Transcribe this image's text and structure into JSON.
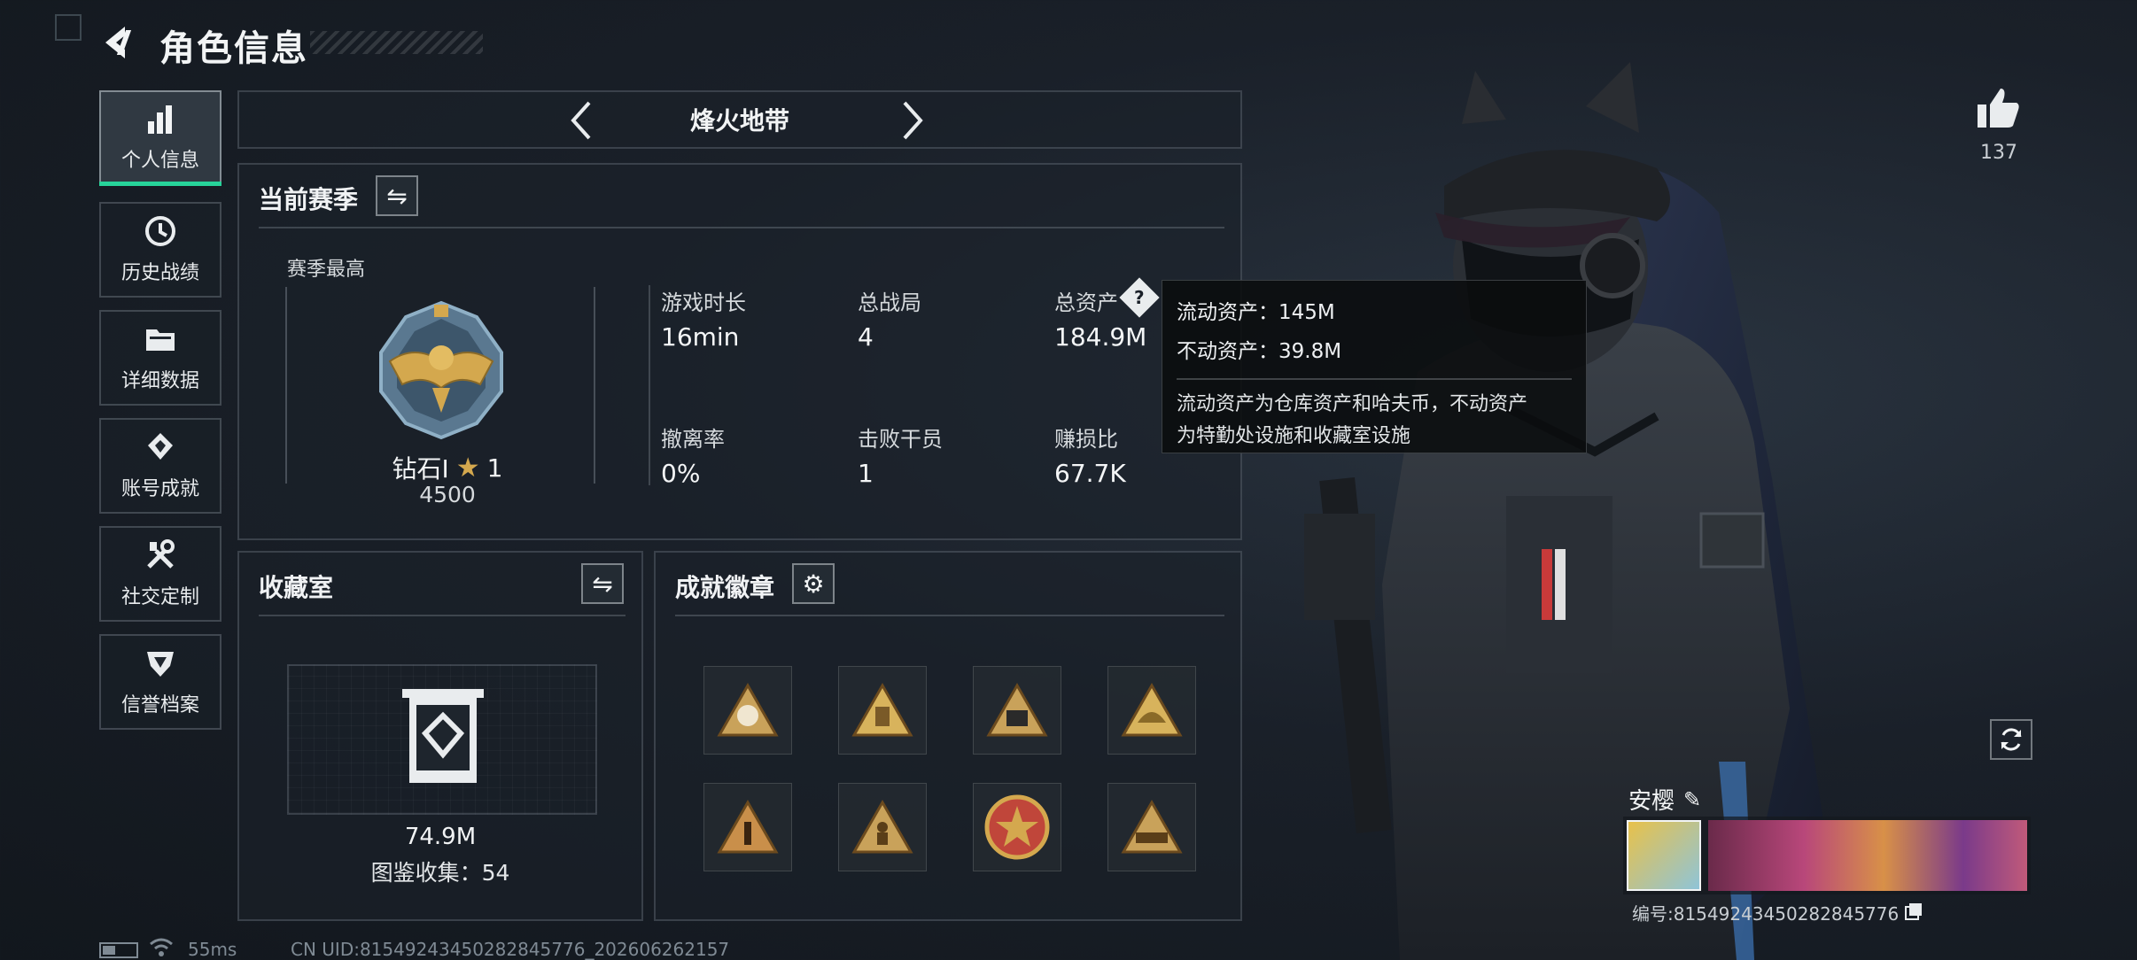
{
  "header": {
    "title": "角色信息"
  },
  "sidebar": {
    "items": [
      {
        "label": "个人信息",
        "icon": "bar-chart-icon",
        "active": true
      },
      {
        "label": "历史战绩",
        "icon": "history-icon",
        "active": false
      },
      {
        "label": "详细数据",
        "icon": "folder-icon",
        "active": false
      },
      {
        "label": "账号成就",
        "icon": "achievement-icon",
        "active": false
      },
      {
        "label": "社交定制",
        "icon": "tools-icon",
        "active": false
      },
      {
        "label": "信誉档案",
        "icon": "credit-icon",
        "active": false
      }
    ]
  },
  "mode_selector": {
    "label": "烽火地带"
  },
  "season": {
    "title": "当前赛季",
    "best_label": "赛季最高",
    "rank": "钻石Ⅰ",
    "stars": "1",
    "score": "4500",
    "stats": [
      {
        "label": "游戏时长",
        "value": "16min"
      },
      {
        "label": "总战局",
        "value": "4"
      },
      {
        "label": "总资产",
        "value": "184.9M"
      },
      {
        "label": "撤离率",
        "value": "0%"
      },
      {
        "label": "击败干员",
        "value": "1"
      },
      {
        "label": "赚损比",
        "value": "67.7K"
      }
    ]
  },
  "tooltip": {
    "liquid": "流动资产：145M",
    "fixed": "不动资产：39.8M",
    "desc_line1": "流动资产为仓库资产和哈夫币，不动资产",
    "desc_line2": "为特勤处设施和收藏室设施"
  },
  "collection": {
    "title": "收藏室",
    "value": "74.9M",
    "catalog": "图鉴收集：54"
  },
  "achievements": {
    "title": "成就徽章",
    "badges": [
      {
        "icon": "badge-skull-icon",
        "color": "#c9a25a"
      },
      {
        "icon": "badge-lantern-icon",
        "color": "#d8b35c"
      },
      {
        "icon": "badge-number-icon",
        "color": "#c9a25a"
      },
      {
        "icon": "badge-helmet-icon",
        "color": "#d8b35c"
      },
      {
        "icon": "badge-one-icon",
        "color": "#c98f4a"
      },
      {
        "icon": "badge-soldier-icon",
        "color": "#c9a25a"
      },
      {
        "icon": "badge-star-emblem-icon",
        "color": "#c0463a"
      },
      {
        "icon": "badge-vehicle-icon",
        "color": "#c9a25a"
      }
    ]
  },
  "likes": {
    "count": "137"
  },
  "player": {
    "name": "安樱",
    "id_text": "编号:81549243450282845776"
  },
  "status_bar": {
    "ping": "55ms",
    "uid": "CN UID:81549243450282845776_202606262157"
  },
  "colors": {
    "accent": "#27d39a",
    "gold": "#d4a84e"
  }
}
